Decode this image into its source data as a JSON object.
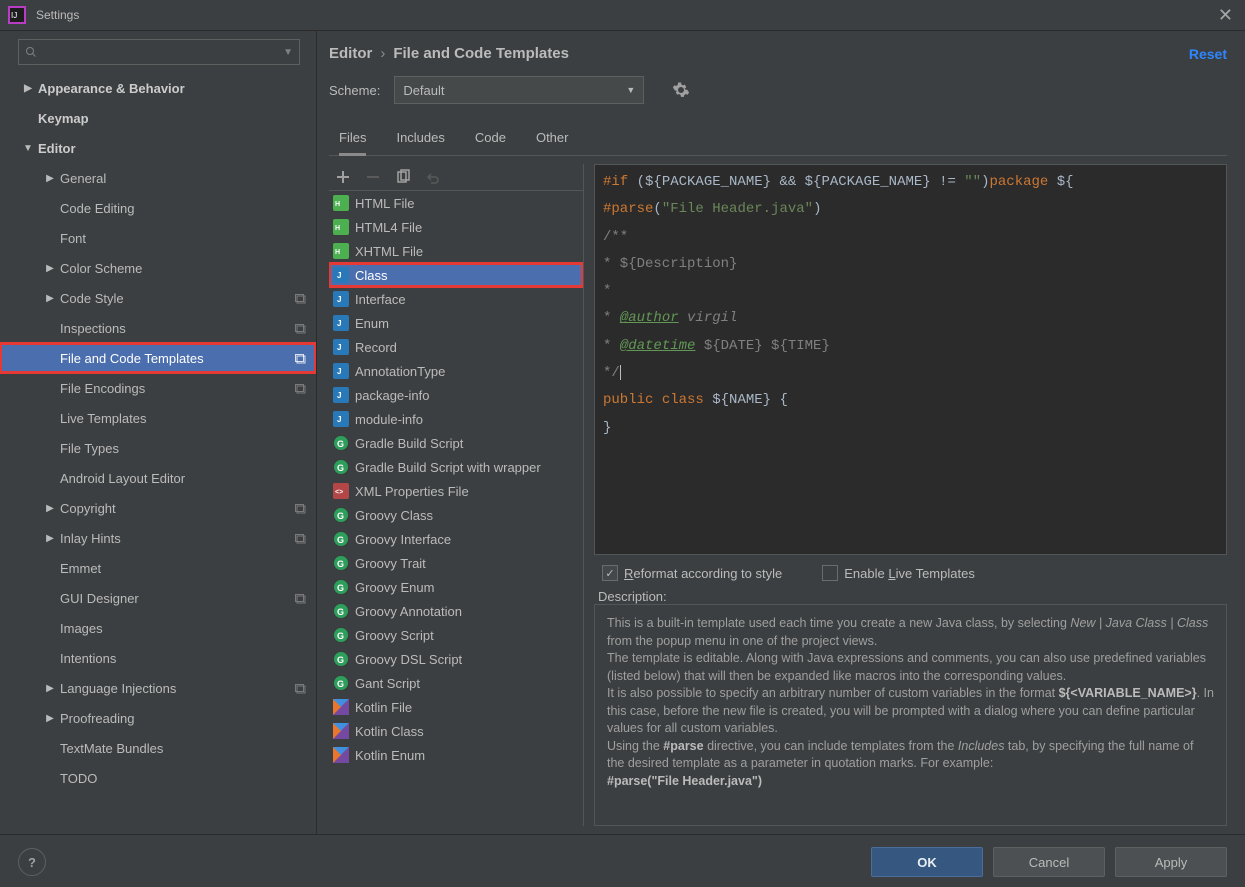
{
  "window": {
    "title": "Settings",
    "close": "✕"
  },
  "search": {
    "placeholder": ""
  },
  "nav": {
    "items": [
      {
        "label": "Appearance & Behavior",
        "level": 0,
        "arrow": "▶"
      },
      {
        "label": "Keymap",
        "level": 0
      },
      {
        "label": "Editor",
        "level": 0,
        "arrow": "▼"
      },
      {
        "label": "General",
        "level": 1,
        "arrow": "▶"
      },
      {
        "label": "Code Editing",
        "level": 1
      },
      {
        "label": "Font",
        "level": 1
      },
      {
        "label": "Color Scheme",
        "level": 1,
        "arrow": "▶"
      },
      {
        "label": "Code Style",
        "level": 1,
        "arrow": "▶",
        "cube": true
      },
      {
        "label": "Inspections",
        "level": 1,
        "cube": true
      },
      {
        "label": "File and Code Templates",
        "level": 1,
        "cube": true,
        "selected": true,
        "highlight": true
      },
      {
        "label": "File Encodings",
        "level": 1,
        "cube": true
      },
      {
        "label": "Live Templates",
        "level": 1
      },
      {
        "label": "File Types",
        "level": 1
      },
      {
        "label": "Android Layout Editor",
        "level": 1
      },
      {
        "label": "Copyright",
        "level": 1,
        "arrow": "▶",
        "cube": true
      },
      {
        "label": "Inlay Hints",
        "level": 1,
        "arrow": "▶",
        "cube": true
      },
      {
        "label": "Emmet",
        "level": 1
      },
      {
        "label": "GUI Designer",
        "level": 1,
        "cube": true
      },
      {
        "label": "Images",
        "level": 1
      },
      {
        "label": "Intentions",
        "level": 1
      },
      {
        "label": "Language Injections",
        "level": 1,
        "arrow": "▶",
        "cube": true
      },
      {
        "label": "Proofreading",
        "level": 1,
        "arrow": "▶"
      },
      {
        "label": "TextMate Bundles",
        "level": 1
      },
      {
        "label": "TODO",
        "level": 1
      }
    ]
  },
  "breadcrumb": {
    "root": "Editor",
    "leaf": "File and Code Templates"
  },
  "reset": "Reset",
  "scheme": {
    "label": "Scheme:",
    "value": "Default"
  },
  "tabs": [
    {
      "label": "Files",
      "active": true
    },
    {
      "label": "Includes"
    },
    {
      "label": "Code"
    },
    {
      "label": "Other"
    }
  ],
  "templates": [
    {
      "label": "HTML File",
      "icon": "html"
    },
    {
      "label": "HTML4 File",
      "icon": "html"
    },
    {
      "label": "XHTML File",
      "icon": "html"
    },
    {
      "label": "Class",
      "icon": "java",
      "selected": true,
      "highlight": true
    },
    {
      "label": "Interface",
      "icon": "java"
    },
    {
      "label": "Enum",
      "icon": "java"
    },
    {
      "label": "Record",
      "icon": "java"
    },
    {
      "label": "AnnotationType",
      "icon": "java"
    },
    {
      "label": "package-info",
      "icon": "java"
    },
    {
      "label": "module-info",
      "icon": "java"
    },
    {
      "label": "Gradle Build Script",
      "icon": "groovy"
    },
    {
      "label": "Gradle Build Script with wrapper",
      "icon": "groovy"
    },
    {
      "label": "XML Properties File",
      "icon": "xml"
    },
    {
      "label": "Groovy Class",
      "icon": "groovy"
    },
    {
      "label": "Groovy Interface",
      "icon": "groovy"
    },
    {
      "label": "Groovy Trait",
      "icon": "groovy"
    },
    {
      "label": "Groovy Enum",
      "icon": "groovy"
    },
    {
      "label": "Groovy Annotation",
      "icon": "groovy"
    },
    {
      "label": "Groovy Script",
      "icon": "groovy"
    },
    {
      "label": "Groovy DSL Script",
      "icon": "groovy"
    },
    {
      "label": "Gant Script",
      "icon": "groovy"
    },
    {
      "label": "Kotlin File",
      "icon": "kotlin"
    },
    {
      "label": "Kotlin Class",
      "icon": "kotlin"
    },
    {
      "label": "Kotlin Enum",
      "icon": "kotlin"
    }
  ],
  "code": {
    "line1_if": "#if",
    "line1_body": " (${PACKAGE_NAME} && ${PACKAGE_NAME} != ",
    "line1_str": "\"\"",
    "line1_pkg": "package",
    "line1_tail": " ${",
    "line2_parse": "#parse",
    "line2_open": "(",
    "line2_str": "\"File Header.java\"",
    "line2_close": ")",
    "c1": "/**",
    "c2": " * ${Description}",
    "c3": " *",
    "c4_star": " * ",
    "c4_tag": "@author",
    "c4_rest": " virgil",
    "c5_star": " * ",
    "c5_tag": "@datetime",
    "c5_rest": " ${DATE} ${TIME}",
    "c6": " */",
    "pub": "public",
    "cls": " class",
    "name": " ${NAME} {",
    "end": "}"
  },
  "checks": {
    "reformat": "Reformat according to style",
    "live": "Enable Live Templates"
  },
  "descLabel": "Description:",
  "description": {
    "l1a": "This is a built-in template used each time you create a new Java class, by selecting ",
    "l1b": "New | Java Class | Class",
    "l1c": " from the popup menu in one of the project views.",
    "l2": "The template is editable. Along with Java expressions and comments, you can also use predefined variables (listed below) that will then be expanded like macros into the corresponding values.",
    "l3a": "It is also possible to specify an arbitrary number of custom variables in the format ",
    "l3b": "${<VARIABLE_NAME>}",
    "l3c": ". In this case, before the new file is created, you will be prompted with a dialog where you can define particular values for all custom variables.",
    "l4a": "Using the ",
    "l4b": "#parse",
    "l4c": " directive, you can include templates from the ",
    "l4d": "Includes",
    "l4e": " tab, by specifying the full name of the desired template as a parameter in quotation marks. For example:",
    "l5": "#parse(\"File Header.java\")"
  },
  "footer": {
    "ok": "OK",
    "cancel": "Cancel",
    "apply": "Apply"
  }
}
